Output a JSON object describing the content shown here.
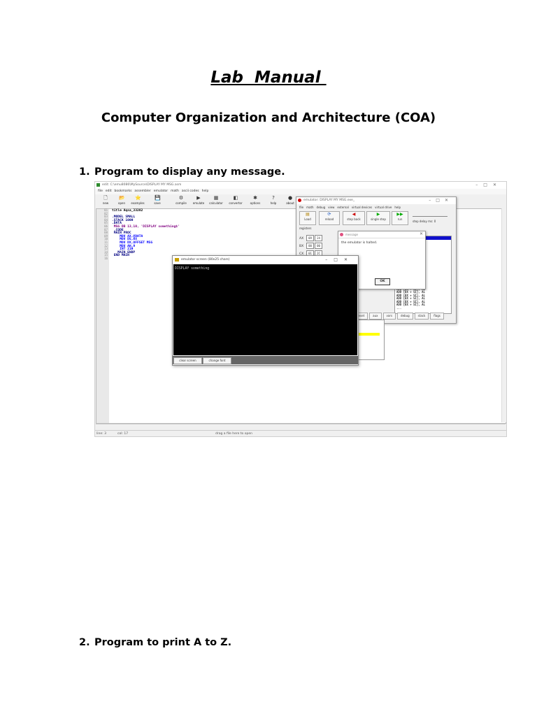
{
  "document": {
    "title": "Lab  Manual ",
    "subtitle": "Computer Organization and Architecture (COA)",
    "sections": [
      {
        "number": "1.",
        "heading": "Program to display any message."
      },
      {
        "number": "2.",
        "heading": "Program to print A to Z."
      }
    ]
  },
  "screenshot": {
    "window_title": "edit: C:\\emu8086\\MySource\\DISPLAY MY MSG.asm",
    "menu": [
      "file",
      "edit",
      "bookmarks",
      "assembler",
      "emulator",
      "math",
      "ascii codes",
      "help"
    ],
    "toolbar": [
      {
        "label": "new",
        "icon": "new-file-icon",
        "glyph": "🗋"
      },
      {
        "label": "open",
        "icon": "open-folder-icon",
        "glyph": "📂"
      },
      {
        "label": "examples",
        "icon": "examples-icon",
        "glyph": "⭐"
      },
      {
        "label": "save",
        "icon": "save-icon",
        "glyph": "💾"
      },
      {
        "label": "compile",
        "icon": "compile-icon",
        "glyph": "⚙"
      },
      {
        "label": "emulate",
        "icon": "emulate-icon",
        "glyph": "▶"
      },
      {
        "label": "calculator",
        "icon": "calculator-icon",
        "glyph": "▦"
      },
      {
        "label": "convertor",
        "icon": "convertor-icon",
        "glyph": "◧"
      },
      {
        "label": "options",
        "icon": "options-icon",
        "glyph": "✱"
      },
      {
        "label": "help",
        "icon": "help-icon",
        "glyph": "?"
      },
      {
        "label": "about",
        "icon": "about-icon",
        "glyph": "●"
      }
    ],
    "line_numbers": [
      "01",
      "02",
      "03",
      "04",
      "05",
      "06",
      "07",
      "08",
      "09",
      "10",
      "11",
      "12",
      "13",
      "14",
      "15",
      "16"
    ],
    "code": [
      {
        "text": "title Aqsa_33282",
        "color": "#000000"
      },
      {
        "text": "",
        "color": "#000000"
      },
      {
        "text": ".MODEL SMALL",
        "color": "#000080"
      },
      {
        "text": ".STACK 100H",
        "color": "#000080"
      },
      {
        "text": ".DATA",
        "color": "#000080"
      },
      {
        "text": " MSG DB 13,10, 'DISPLAY something$'",
        "color": "#800080"
      },
      {
        "text": " .CODE",
        "color": "#000080"
      },
      {
        "text": " MAIN PROC",
        "color": "#000080"
      },
      {
        "text": "    MOV AX,@DATA",
        "color": "#0000ff"
      },
      {
        "text": "    MOV DS,AX",
        "color": "#0000ff"
      },
      {
        "text": "    MOV DX,OFFSET MSG",
        "color": "#0000ff"
      },
      {
        "text": "    MOV AH,9",
        "color": "#0000ff"
      },
      {
        "text": "    INT 21H",
        "color": "#0000ff"
      },
      {
        "text": "   MAIN ENDP",
        "color": "#000080"
      },
      {
        "text": " END MAIN",
        "color": "#000080"
      }
    ],
    "status": {
      "line": "line: 3",
      "col": "col: 17",
      "hint": "drag a file here to open"
    },
    "emulator": {
      "title": "emulator: DISPLAY MY MSG.exe_",
      "menu": [
        "file",
        "math",
        "debug",
        "view",
        "external",
        "virtual devices",
        "virtual drive",
        "help"
      ],
      "buttons": [
        "Load",
        "reload",
        "step back",
        "single step",
        "run"
      ],
      "step_delay": "step delay ms: 0",
      "registers_label": "registers",
      "registers": [
        {
          "name": "AX",
          "h": "09",
          "l": "24"
        },
        {
          "name": "BX",
          "h": "00",
          "l": "00"
        },
        {
          "name": "CX",
          "h": "01",
          "l": "2C"
        }
      ],
      "disasm": [
        "ADD [BX + SI], AL",
        "ADD [BX + SI], AL",
        "ADD [BX + SI], AL",
        "ADD [BX + SI], AL",
        "ADD [BX + SI], AL",
        "ADD [BX + SI], AL",
        "ADD [BX + SI], AL",
        "ADD [BX + SI], AL",
        "ADD [BX + SI], AL",
        "ADD [BX + SI], AL",
        "ADD [BX + SI], AL",
        "ADD [BX + SI], AL",
        "ADD [BX + SI], AL",
        "ADD [BX + SI], AL",
        "ADD [BX + SI], AL",
        "ADD [BX + SI], AL",
        "ADD [BX + SI], AL",
        "ADD [BX + SI], AL",
        "ADD [BX + SI], AL",
        "ADD [BX + SI], AL",
        "ADD [BX + SI], AL",
        "ADD [BX + SI], AL",
        "..."
      ],
      "bottom_buttons": [
        "reset",
        "aux",
        "vars",
        "debug",
        "stack",
        "flags"
      ]
    },
    "message_box": {
      "title": "message",
      "text": "the emulator is halted.",
      "ok": "OK"
    },
    "emulator_screen": {
      "title": "emulator screen (80x25 chars)",
      "output": "DISPLAY something",
      "buttons": [
        "clear screen",
        "change font"
      ]
    }
  }
}
